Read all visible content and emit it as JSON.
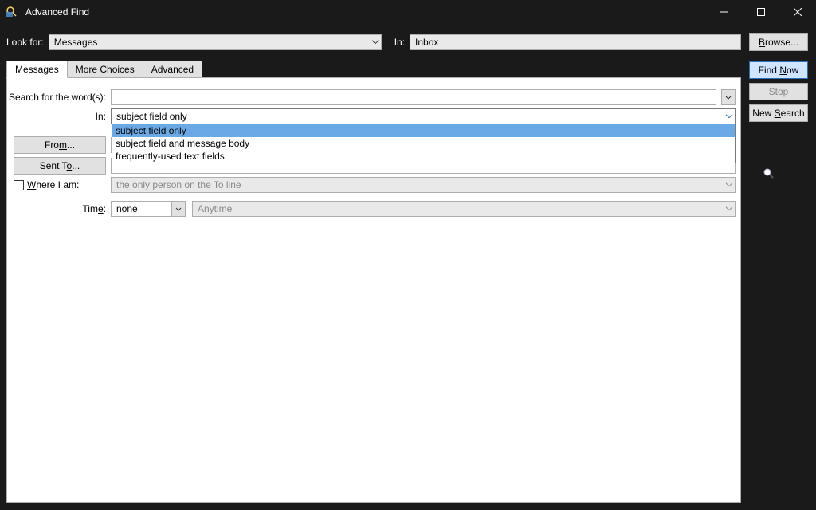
{
  "titlebar": {
    "title": "Advanced Find"
  },
  "toprow": {
    "look_for_label": "Look for:",
    "look_for_value": "Messages",
    "in_label": "In:",
    "in_value": "Inbox"
  },
  "buttons": {
    "browse": "Browse...",
    "find_now": "Find Now",
    "stop": "Stop",
    "new_search": "New Search"
  },
  "tabs": {
    "messages": "Messages",
    "more_choices": "More Choices",
    "advanced": "Advanced"
  },
  "form": {
    "search_label": "Search for the word(s):",
    "in_label": "In:",
    "in_value": "subject field only",
    "in_options": {
      "opt0": "subject field only",
      "opt1": "subject field and message body",
      "opt2": "frequently-used text fields"
    },
    "from_label": "From...",
    "sent_to_label": "Sent To...",
    "where_label": "Where I am:",
    "where_value": "the only person on the To line",
    "time_label": "Time:",
    "time_value1": "none",
    "time_value2": "Anytime"
  }
}
